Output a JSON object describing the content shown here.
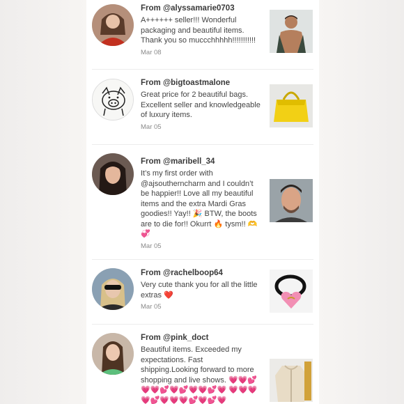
{
  "reviews": [
    {
      "from": "From @alyssamarie0703",
      "text": "A++++++ seller!!! Wonderful packaging and beautiful items. Thank you so muccchhhhh!!!!!!!!!!!",
      "date": "Mar 08",
      "avatar_icon": "woman-red-top-avatar",
      "thumb_icon": "man-portrait-photo"
    },
    {
      "from": "From @bigtoastmalone",
      "text": "Great price for 2 beautiful bags. Excellent seller and knowledgeable of luxury items.",
      "date": "Mar 05",
      "avatar_icon": "pig-sketch-avatar",
      "thumb_icon": "yellow-handbag-photo"
    },
    {
      "from": "From @maribell_34",
      "text": "It’s my first order with @ajsoutherncharm and I couldn’t be happier!! Love all my beautiful items and the extra Mardi Gras goodies!! Yay!! 🎉 BTW, the boots are to die for!! Okurrt 🔥 tysm!! 🫶💞",
      "date": "Mar 05",
      "avatar_icon": "woman-dark-hair-avatar",
      "thumb_icon": "man-portrait-photo"
    },
    {
      "from": "From @rachelboop64",
      "text": "Very cute thank you for all the little extras ❤️",
      "date": "Mar 05",
      "avatar_icon": "woman-sunglasses-avatar",
      "thumb_icon": "hair-tie-heart-charm-photo"
    },
    {
      "from": "From @pink_doct",
      "text": "Beautiful items. Exceeded my expectations. Fast shipping.Looking forward to more shopping and live shows. 💗💗💕💗💗💕💗💕💗💗💕💗 💗💗💗💗💕💗💗💗💕💗💕💗",
      "date": "",
      "avatar_icon": "woman-green-shirt-avatar",
      "thumb_icon": "cream-jacket-photo"
    }
  ],
  "colors": {
    "page_bg": "#ffffff",
    "side_bg": "#f3f1ef",
    "text": "#444444",
    "date": "#8a8a8a"
  }
}
